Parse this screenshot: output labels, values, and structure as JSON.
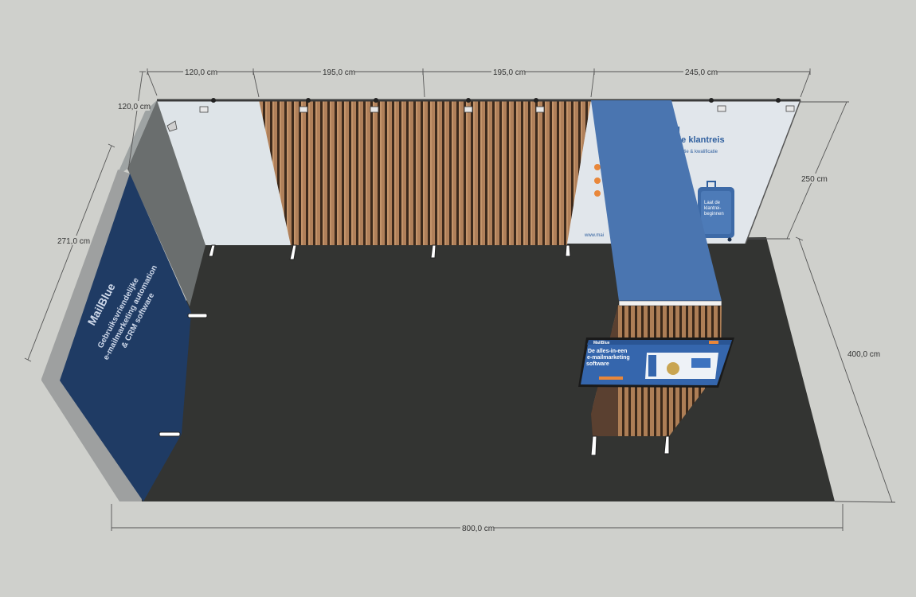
{
  "dimensions": {
    "top_segment_1": "120,0 cm",
    "top_segment_2": "195,0 cm",
    "top_segment_3": "195,0 cm",
    "top_segment_4": "245,0 cm",
    "left_depth": "120,0 cm",
    "left_wall_length": "271,0 cm",
    "right_height": "250 cm",
    "right_depth": "400,0 cm",
    "bottom_width": "800,0 cm"
  },
  "back_banner": {
    "headline_line1": "g",
    "headline_line2": "ele klantreis",
    "subline": "ntatie & kwalificatie",
    "url_fragment": "www.mai",
    "suitcase_text_line1": "Laat de",
    "suitcase_text_line2": "klantrei-",
    "suitcase_text_line3": "beginnen"
  },
  "left_panel": {
    "logo_text": "MailBlue",
    "line1": "Gebruiksvriendelijke",
    "line2": "e-mailmarketing automation",
    "line3": "& CRM software"
  },
  "screen": {
    "logo_text": "MailBlue",
    "headline_line1": "De alles-in-een",
    "headline_line2": "e-mailmarketing",
    "headline_line3": "software"
  },
  "colors": {
    "background": "#cfd0cc",
    "floor": "#333432",
    "brand_blue": "#3f6fb0",
    "navy_panel": "#1f3b64",
    "wood": "#a87a52",
    "wall_white": "#dfe5ea",
    "orange_accent": "#e9873a"
  }
}
